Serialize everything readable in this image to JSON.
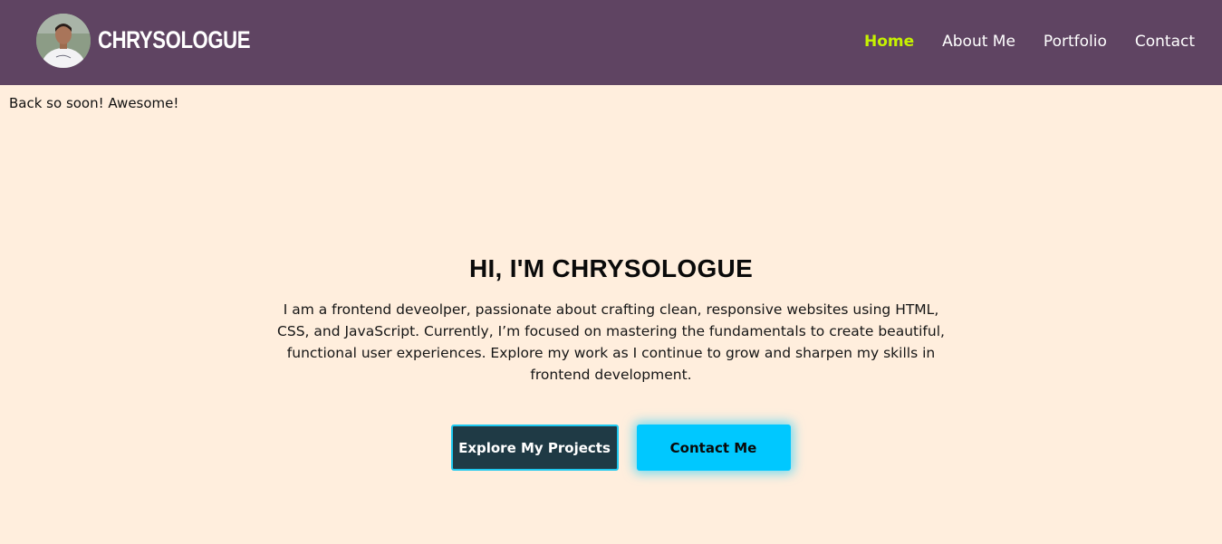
{
  "header": {
    "brand": "CHRYSOLOGUE",
    "nav": [
      {
        "label": "Home",
        "active": true
      },
      {
        "label": "About Me",
        "active": false
      },
      {
        "label": "Portfolio",
        "active": false
      },
      {
        "label": "Contact",
        "active": false
      }
    ]
  },
  "welcome_message": "Back so soon! Awesome!",
  "hero": {
    "title": "HI, I'M CHRYSOLOGUE",
    "description": "I am a frontend deveolper, passionate about crafting clean, responsive websites using HTML, CSS, and JavaScript. Currently, I’m focused on mastering the fundamentals to create beautiful, functional user experiences. Explore my work as I continue to grow and sharpen my skills in frontend development.",
    "primary_button": "Explore My Projects",
    "secondary_button": "Contact Me"
  },
  "colors": {
    "navbar_bg": "#5f4462",
    "page_bg": "#ffeedd",
    "active_link": "#c6f200",
    "primary_button_bg": "#1f3a45",
    "accent": "#00c8ff"
  }
}
